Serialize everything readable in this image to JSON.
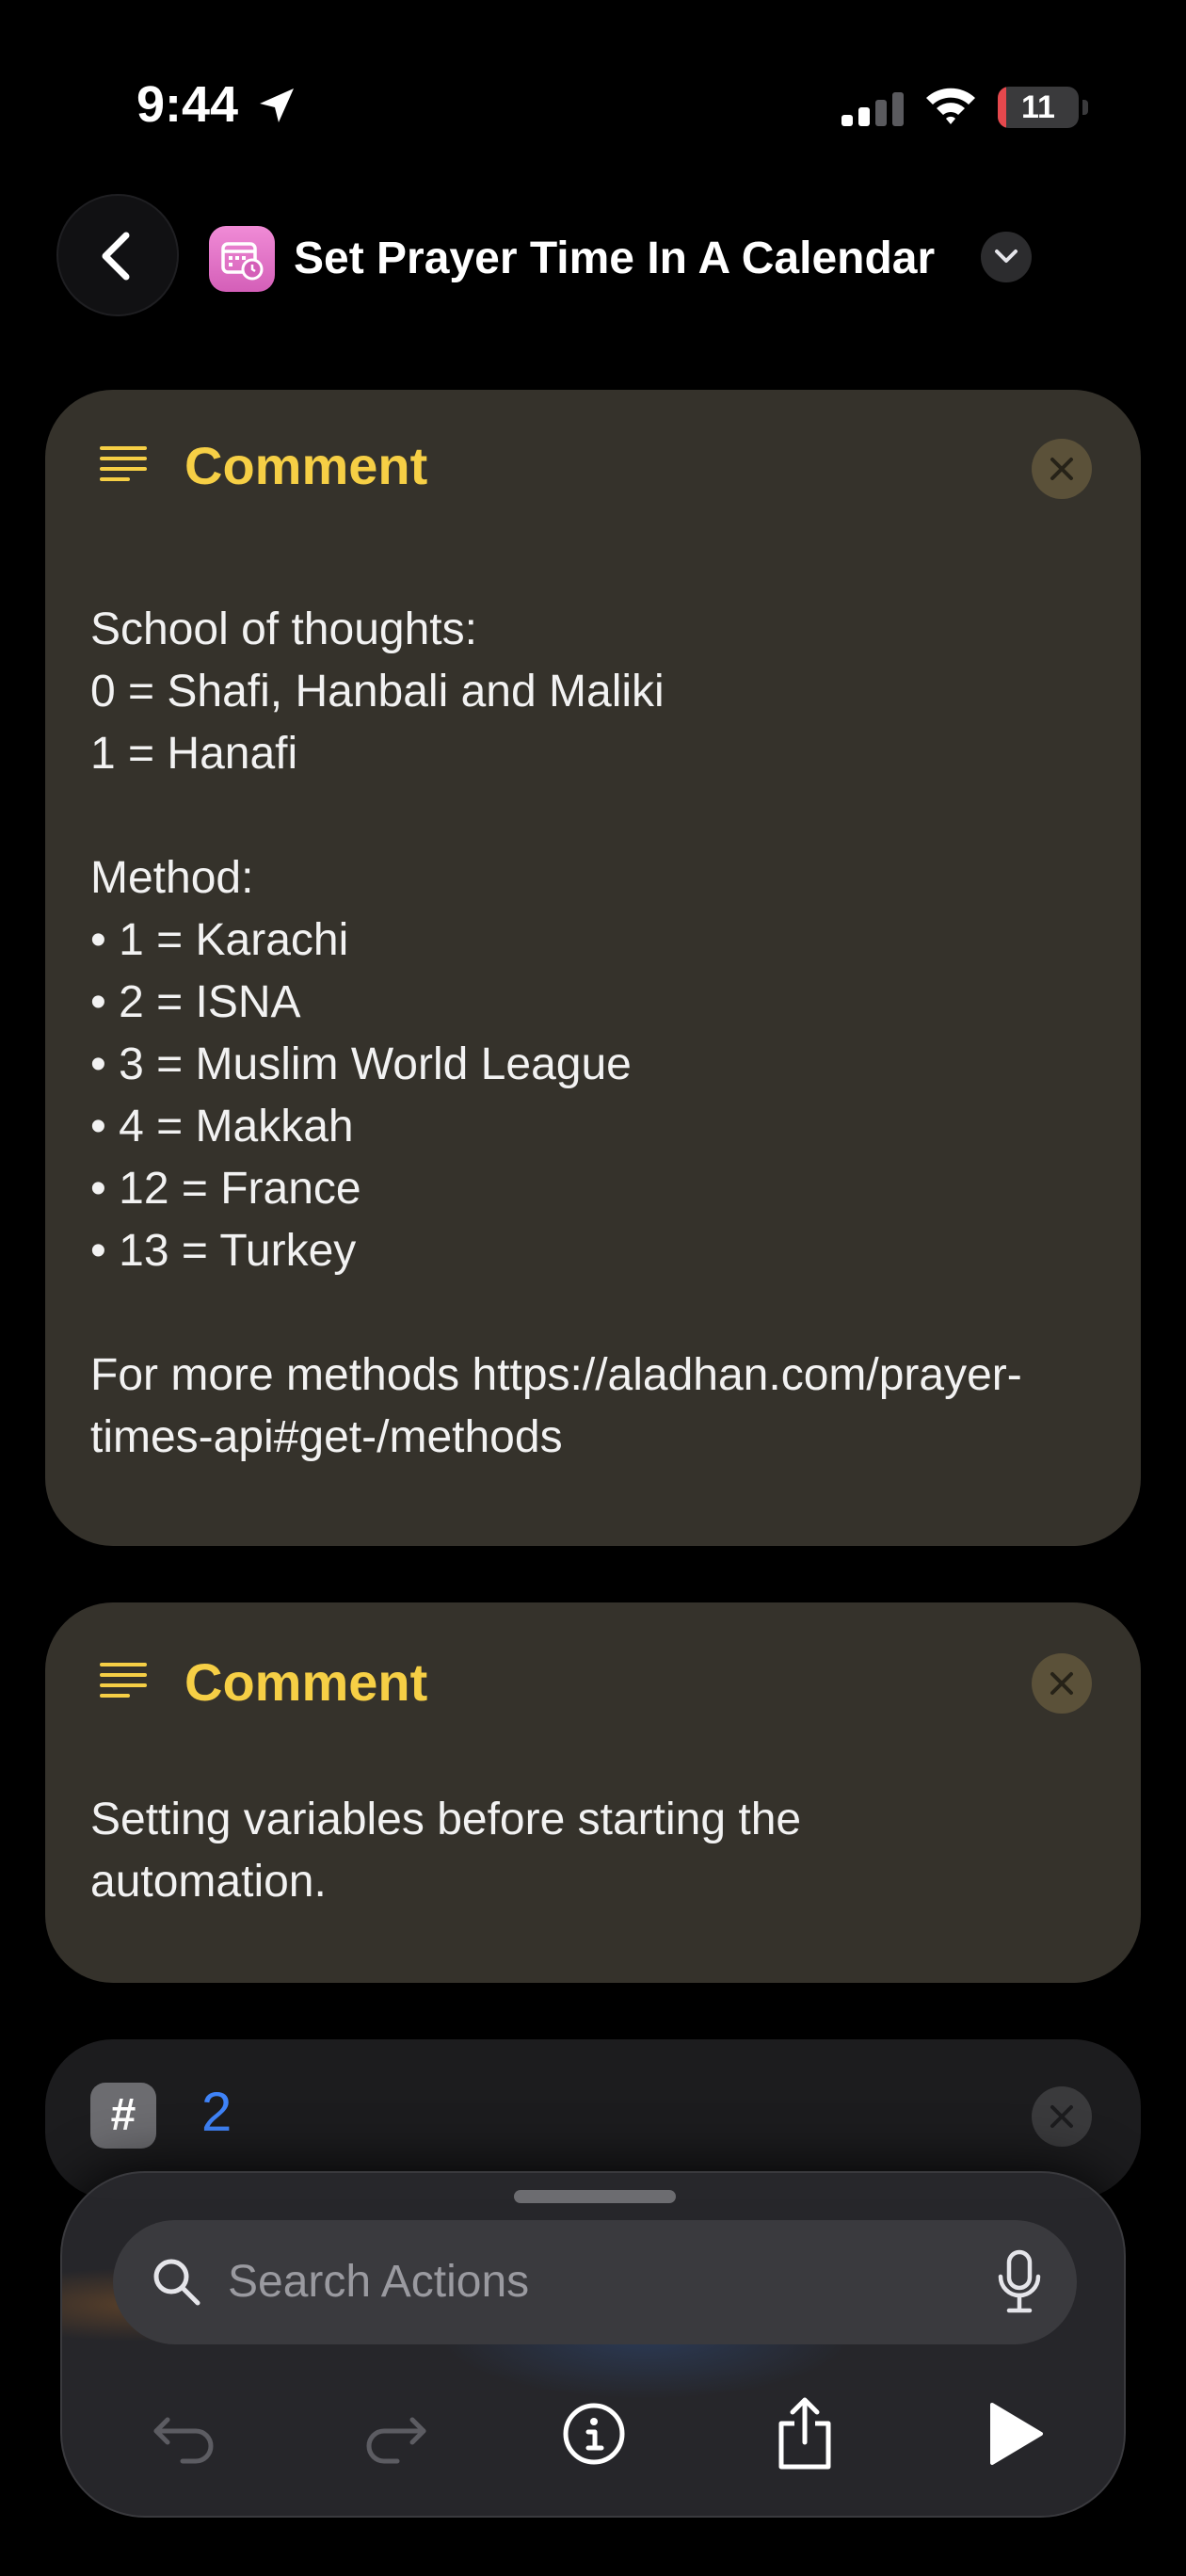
{
  "status_bar": {
    "time": "9:44",
    "battery": "11",
    "battery_level": 0.11
  },
  "header": {
    "title": "Set Prayer Time In A Calendar"
  },
  "cards": [
    {
      "title": "Comment",
      "lines": [
        "School of thoughts:",
        "0 = Shafi, Hanbali and Maliki",
        "1 = Hanafi",
        "",
        "Method:",
        "• 1 = Karachi",
        "• 2 = ISNA",
        "• 3 = Muslim World League",
        "• 4 = Makkah",
        "• 12 = France",
        "• 13 = Turkey",
        "",
        "For more methods https://aladhan.com/prayer-",
        "times-api#get-/methods"
      ]
    },
    {
      "title": "Comment",
      "lines": [
        "Setting variables before starting the",
        "automation."
      ]
    }
  ],
  "number_action": {
    "icon": "#",
    "value": "2"
  },
  "toolbar": {
    "search_placeholder": "Search Actions"
  },
  "icons": {
    "comment": "lines-icon",
    "close": "close-icon",
    "undo": "undo-icon",
    "redo": "redo-icon",
    "info": "info-icon",
    "share": "share-icon",
    "run": "play-icon"
  },
  "colors": {
    "accent_yellow": "#f6cf45",
    "card_bg": "#35322b",
    "number_blue": "#3f83f8"
  }
}
